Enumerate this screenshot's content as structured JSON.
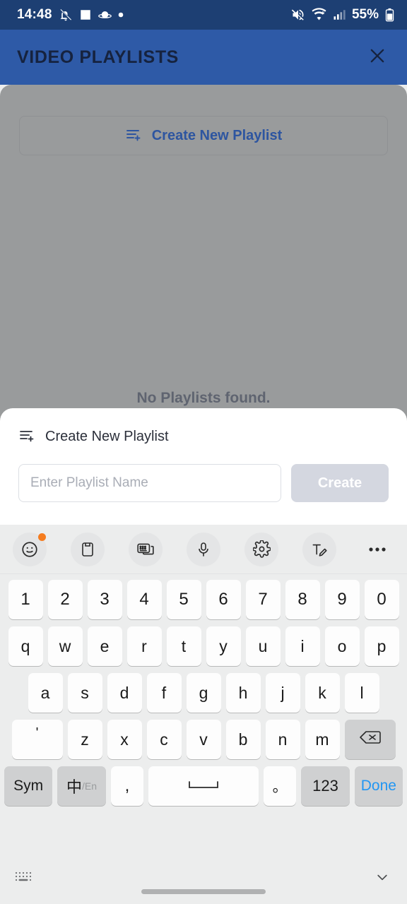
{
  "status_bar": {
    "time": "14:48",
    "battery_percent": "55%",
    "left_icons": [
      "mute-bell-icon",
      "image-icon",
      "planet-icon",
      "dot-icon"
    ],
    "right_icons": [
      "volume-mute-icon",
      "wifi-6-icon",
      "cellular-signal-icon",
      "battery-icon"
    ],
    "background_color": "#1d3f73"
  },
  "app_bar": {
    "title": "VIDEO PLAYLISTS",
    "close_icon": "close-icon",
    "background_color": "#2e5aa7",
    "title_color": "#16233f"
  },
  "content": {
    "create_button_label": "Create New Playlist",
    "create_button_icon": "playlist-add-icon",
    "create_button_color": "#2d55a0",
    "empty_message": "No Playlists found.",
    "overlay_color": "#999b9c"
  },
  "sheet": {
    "heading": "Create New Playlist",
    "heading_icon": "playlist-add-icon",
    "input_placeholder": "Enter Playlist Name",
    "input_value": "",
    "create_label": "Create",
    "create_disabled_color": "#d4d7e0"
  },
  "keyboard": {
    "toolbar": [
      {
        "name": "emoji-icon",
        "badge": true
      },
      {
        "name": "clipboard-icon",
        "badge": false
      },
      {
        "name": "keyboard-switch-icon",
        "badge": false
      },
      {
        "name": "microphone-icon",
        "badge": false
      },
      {
        "name": "gear-icon",
        "badge": false
      },
      {
        "name": "handwriting-icon",
        "badge": false
      },
      {
        "name": "more-options-icon",
        "badge": false
      }
    ],
    "number_row": [
      "1",
      "2",
      "3",
      "4",
      "5",
      "6",
      "7",
      "8",
      "9",
      "0"
    ],
    "row_q": [
      "q",
      "w",
      "e",
      "r",
      "t",
      "y",
      "u",
      "i",
      "o",
      "p"
    ],
    "row_a": [
      "a",
      "s",
      "d",
      "f",
      "g",
      "h",
      "j",
      "k",
      "l"
    ],
    "row_z": [
      "z",
      "x",
      "c",
      "v",
      "b",
      "n",
      "m"
    ],
    "apostrophe_key": "'",
    "backspace_icon": "backspace-icon",
    "function_row": {
      "sym": "Sym",
      "lang_main": "中",
      "lang_sub": "/En",
      "comma": ",",
      "space_icon": "space-bar-icon",
      "period": "。",
      "numeric": "123",
      "done": "Done",
      "done_color": "#2196f3"
    },
    "bottom_bar": {
      "layout_icon": "keyboard-layout-icon",
      "hide_icon": "chevron-down-icon"
    }
  }
}
